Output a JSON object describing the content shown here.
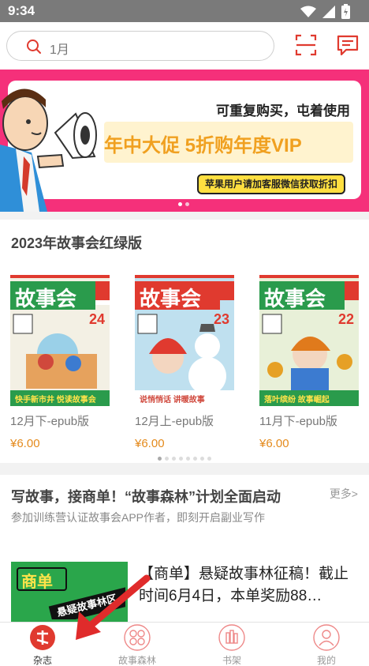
{
  "status": {
    "time": "9:34"
  },
  "search": {
    "placeholder": "1月"
  },
  "banner": {
    "top_text": "可重复购买，屯着使用",
    "main_text": "年中大促 5折购年度VIP",
    "sub_text": "苹果用户请加客服微信获取折扣"
  },
  "section": {
    "title": "2023年故事会红绿版",
    "items": [
      {
        "name": "12月下-epub版",
        "price": "¥6.00",
        "cover_title": "故事会",
        "issue": "24",
        "cover_caption": "快手新市井 悦读故事会"
      },
      {
        "name": "12月上-epub版",
        "price": "¥6.00",
        "cover_title": "故事会",
        "issue": "23",
        "cover_caption": "说悄悄话 讲暖故事"
      },
      {
        "name": "11月下-epub版",
        "price": "¥6.00",
        "cover_title": "故事会",
        "issue": "22",
        "cover_caption": "落叶缤纷 故事崛起"
      }
    ]
  },
  "promo": {
    "title": "写故事，接商单！“故事森林”计划全面启动",
    "more": "更多>",
    "desc": "参加训练营认证故事会APP作者，即刻开启副业写作",
    "article_title": "【商单】悬疑故事林征稿！截止时间6月4日，本单奖励88…",
    "thumb_text_1": "商单",
    "thumb_text_2": "悬疑故事林区"
  },
  "tabs": [
    {
      "label": "杂志",
      "active": true
    },
    {
      "label": "故事森林",
      "active": false
    },
    {
      "label": "书架",
      "active": false
    },
    {
      "label": "我的",
      "active": false
    }
  ],
  "colors": {
    "brand": "#e03a2f",
    "price": "#e48a1c",
    "banner_bg": "#f5307a"
  }
}
